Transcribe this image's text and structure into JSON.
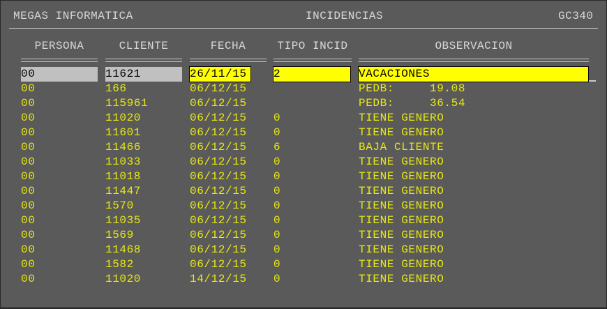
{
  "header": {
    "company": "MEGAS INFORMATICA",
    "title": "INCIDENCIAS",
    "code": "GC340"
  },
  "columns": {
    "persona": "PERSONA",
    "cliente": "CLIENTE",
    "fecha": "FECHA",
    "tipo": "TIPO INCID",
    "observacion": "OBSERVACION"
  },
  "edit_row": {
    "persona": "00",
    "cliente": "11621",
    "fecha": "26/11/15",
    "tipo": "2",
    "observacion": "VACACIONES"
  },
  "rows": [
    {
      "persona": "00",
      "cliente": "166",
      "fecha": "06/12/15",
      "tipo": "",
      "observacion": "PEDB:     19.08"
    },
    {
      "persona": "00",
      "cliente": "115961",
      "fecha": "06/12/15",
      "tipo": "",
      "observacion": "PEDB:     36.54"
    },
    {
      "persona": "00",
      "cliente": "11020",
      "fecha": "06/12/15",
      "tipo": "0",
      "observacion": "TIENE GENERO"
    },
    {
      "persona": "00",
      "cliente": "11601",
      "fecha": "06/12/15",
      "tipo": "0",
      "observacion": "TIENE GENERO"
    },
    {
      "persona": "00",
      "cliente": "11466",
      "fecha": "06/12/15",
      "tipo": "6",
      "observacion": "BAJA CLIENTE"
    },
    {
      "persona": "00",
      "cliente": "11033",
      "fecha": "06/12/15",
      "tipo": "0",
      "observacion": "TIENE GENERO"
    },
    {
      "persona": "00",
      "cliente": "11018",
      "fecha": "06/12/15",
      "tipo": "0",
      "observacion": "TIENE GENERO"
    },
    {
      "persona": "00",
      "cliente": "11447",
      "fecha": "06/12/15",
      "tipo": "0",
      "observacion": "TIENE GENERO"
    },
    {
      "persona": "00",
      "cliente": "1570",
      "fecha": "06/12/15",
      "tipo": "0",
      "observacion": "TIENE GENERO"
    },
    {
      "persona": "00",
      "cliente": "11035",
      "fecha": "06/12/15",
      "tipo": "0",
      "observacion": "TIENE GENERO"
    },
    {
      "persona": "00",
      "cliente": "1569",
      "fecha": "06/12/15",
      "tipo": "0",
      "observacion": "TIENE GENERO"
    },
    {
      "persona": "00",
      "cliente": "11468",
      "fecha": "06/12/15",
      "tipo": "0",
      "observacion": "TIENE GENERO"
    },
    {
      "persona": "00",
      "cliente": "1582",
      "fecha": "06/12/15",
      "tipo": "0",
      "observacion": "TIENE GENERO"
    },
    {
      "persona": "00",
      "cliente": "11020",
      "fecha": "14/12/15",
      "tipo": "0",
      "observacion": "TIENE GENERO"
    }
  ],
  "colors": {
    "background": "#5a5a5a",
    "text_data": "#e8e814",
    "text_header": "#d8d8d8",
    "edit_grey": "#c0c0c0",
    "edit_yellow": "#ffff00"
  }
}
